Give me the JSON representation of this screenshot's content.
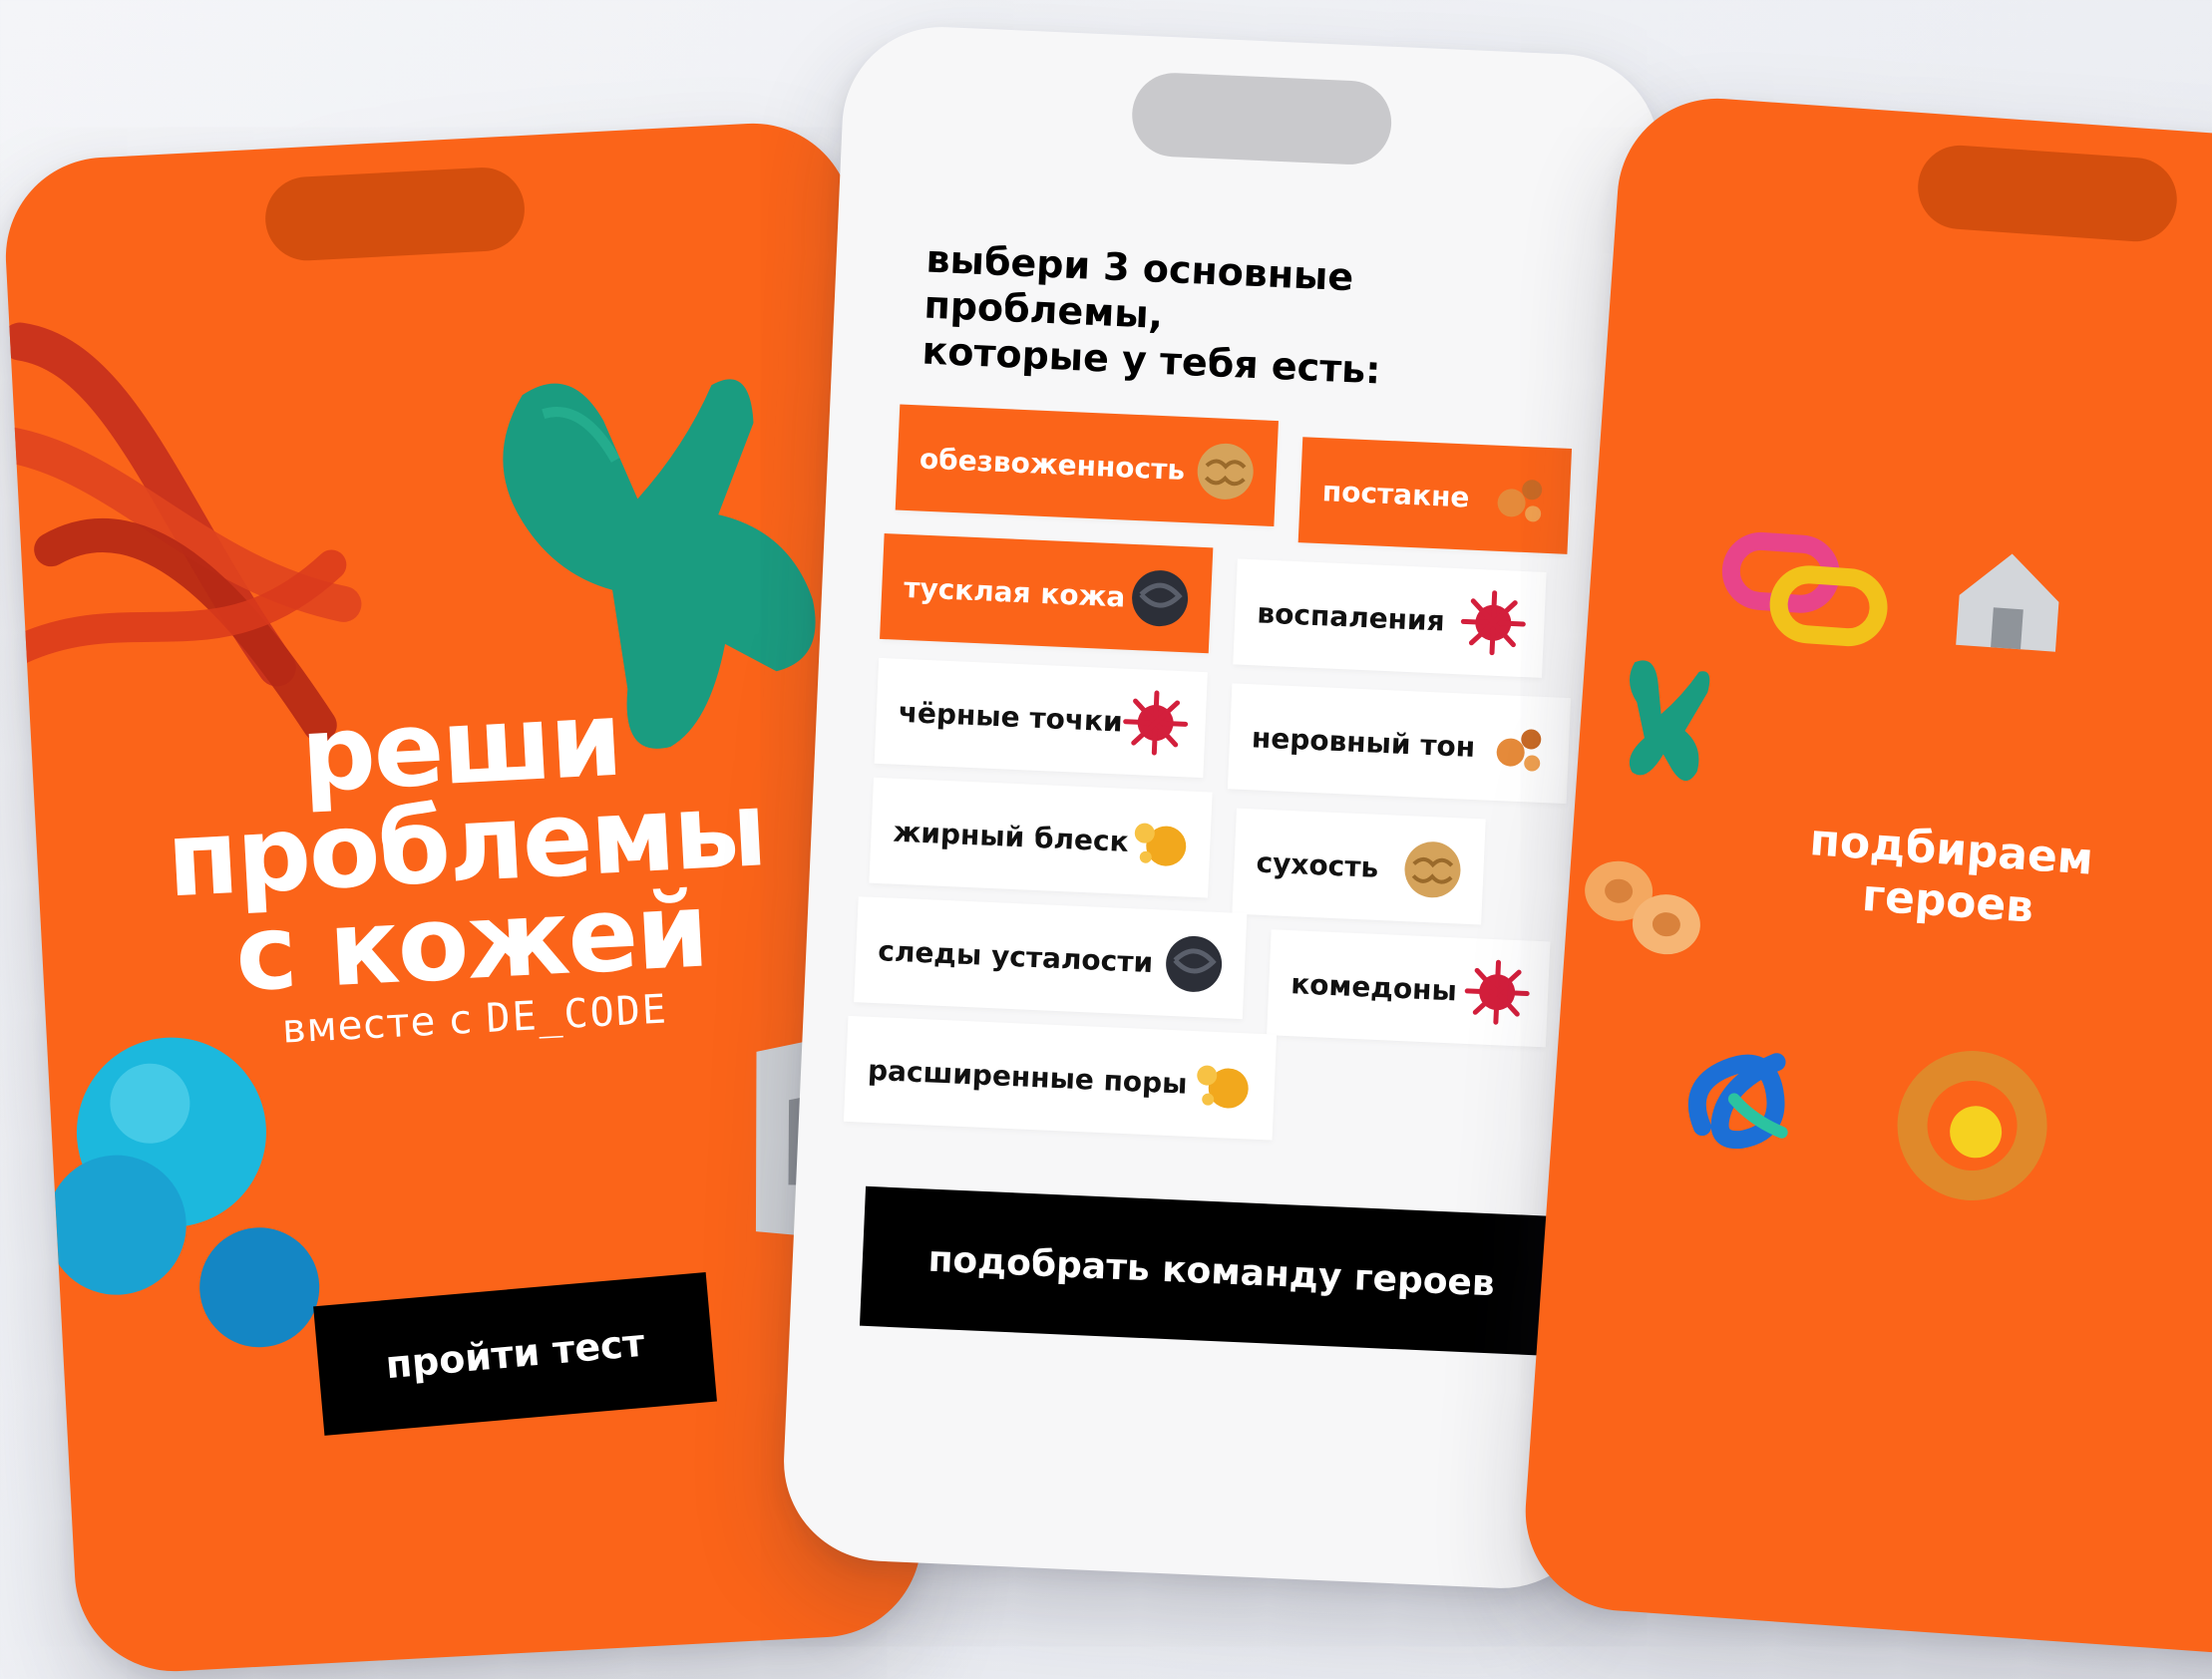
{
  "left_screen": {
    "title_lines": [
      "реши",
      "проблемы",
      "с кожей"
    ],
    "subtitle_prefix": "вместе с",
    "brand": "DE_CODE",
    "button_label": "пройти тест"
  },
  "middle_screen": {
    "question_line1": "выбери 3 основные проблемы,",
    "question_line2": "которые у тебя есть:",
    "options": [
      {
        "label": "обезвоженность",
        "selected": true,
        "icon": "walnut-icon"
      },
      {
        "label": "постакне",
        "selected": true,
        "icon": "droplets-icon"
      },
      {
        "label": "тусклая кожа",
        "selected": true,
        "icon": "dark-blob-icon"
      },
      {
        "label": "воспаления",
        "selected": false,
        "icon": "spiky-ball-icon"
      },
      {
        "label": "чёрные точки",
        "selected": false,
        "icon": "spiky-ball-icon"
      },
      {
        "label": "неровный тон",
        "selected": false,
        "icon": "droplets-icon"
      },
      {
        "label": "жирный блеск",
        "selected": false,
        "icon": "oil-drops-icon"
      },
      {
        "label": "сухость",
        "selected": false,
        "icon": "walnut-icon"
      },
      {
        "label": "следы усталости",
        "selected": false,
        "icon": "dark-blob-icon"
      },
      {
        "label": "комедоны",
        "selected": false,
        "icon": "spiky-ball-icon"
      },
      {
        "label": "расширенные поры",
        "selected": false,
        "icon": "oil-drops-icon"
      }
    ],
    "button_label": "подобрать команду героев"
  },
  "right_screen": {
    "title_line1": "подбираем",
    "title_line2": "героев"
  },
  "colors": {
    "brand_orange": "#fb6419",
    "notch_orange": "#d44e0d",
    "button_black": "#000000",
    "screen_white": "#f7f7f8"
  }
}
